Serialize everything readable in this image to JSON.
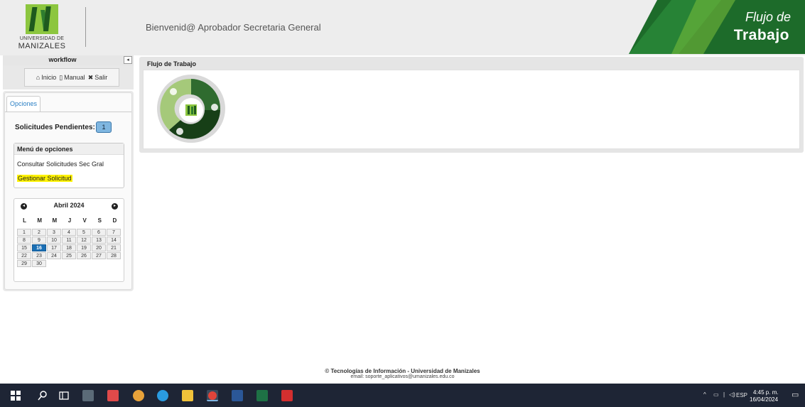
{
  "header": {
    "logo_line1": "UNIVERSIDAD DE",
    "logo_line2": "MANIZALES",
    "welcome": "Bienvenid@ Aprobador Secretaria General",
    "banner_line1": "Flujo de",
    "banner_line2": "Trabajo",
    "brand_green": "#1f6e1f"
  },
  "sidebar": {
    "title": "workflow",
    "collapse_glyph": "◂",
    "nav": {
      "inicio": "Inicio",
      "manual": "Manual",
      "salir": "Salir"
    },
    "tab_label": "Opciones",
    "pending_label": "Solicitudes Pendientes:",
    "pending_count": "1",
    "menu": {
      "title": "Menú de opciones",
      "items": [
        "Consultar Solicitudes Sec Gral",
        "Gestionar Solicitud"
      ]
    },
    "calendar": {
      "month_label": "Abril 2024",
      "prev_glyph": "◂",
      "next_glyph": "▸",
      "weekdays": [
        "L",
        "M",
        "M",
        "J",
        "V",
        "S",
        "D"
      ],
      "today": 16,
      "days": [
        1,
        2,
        3,
        4,
        5,
        6,
        7,
        8,
        9,
        10,
        11,
        12,
        13,
        14,
        15,
        16,
        17,
        18,
        19,
        20,
        21,
        22,
        23,
        24,
        25,
        26,
        27,
        28,
        29,
        30
      ]
    }
  },
  "main": {
    "title": "Flujo de Trabajo"
  },
  "footer": {
    "line1": "© Tecnologías de Información - Universidad de Manizales",
    "line2": "email: soporte_aplicativos@umanizales.edu.co"
  },
  "taskbar": {
    "lang": "ESP",
    "time": "4:45 p. m.",
    "date": "16/04/2024",
    "icons": [
      "windows-start-icon",
      "search-icon",
      "task-view-icon",
      "calculator-icon",
      "media-app-icon",
      "paint-icon",
      "edge-browser-icon",
      "file-explorer-icon",
      "chrome-icon",
      "word-icon",
      "excel-icon",
      "acrobat-icon"
    ]
  }
}
